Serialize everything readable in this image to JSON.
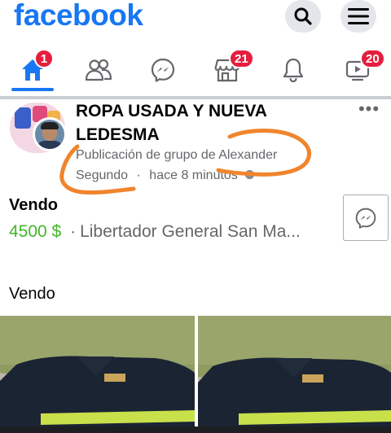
{
  "app": {
    "logo_text": "facebook",
    "brand_color": "#1877f2"
  },
  "topbar": {
    "search_icon": "search-icon",
    "menu_icon": "hamburger-menu-icon"
  },
  "nav": {
    "tabs": [
      {
        "name": "home",
        "icon": "home-icon",
        "badge": "1",
        "active": true
      },
      {
        "name": "friends",
        "icon": "friends-icon",
        "badge": ""
      },
      {
        "name": "messenger",
        "icon": "messenger-icon",
        "badge": ""
      },
      {
        "name": "marketplace",
        "icon": "marketplace-icon",
        "badge": "21"
      },
      {
        "name": "notifications",
        "icon": "bell-icon",
        "badge": ""
      },
      {
        "name": "watch",
        "icon": "watch-icon",
        "badge": "20"
      }
    ],
    "badge_color": "#e41e3f"
  },
  "post": {
    "group_name": "ROPA USADA Y NUEVA LEDESMA",
    "meta_line1": "Publicación de grupo de Alexander",
    "meta_line2_name": "Segundo",
    "meta_separator": "·",
    "meta_time": "hace 8 minutos",
    "privacy_icon": "globe-icon",
    "more_label": "•••",
    "listing": {
      "title": "Vendo",
      "price": "4500 $",
      "separator": "·",
      "location": "Libertador General San Ma..."
    },
    "message_button_icon": "messenger-icon",
    "text": "Vendo",
    "price_color": "#42b72a"
  },
  "annotation": {
    "scribble_color": "#f0852d"
  }
}
